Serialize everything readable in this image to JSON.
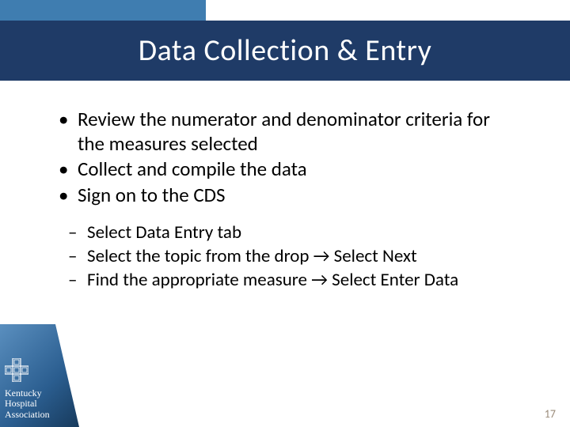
{
  "title": "Data Collection & Entry",
  "bullets": {
    "b1": "Review the numerator and denominator criteria for the measures selected",
    "b2": "Collect and compile the data",
    "b3": "Sign on to the CDS"
  },
  "sub": {
    "s1": "Select Data Entry tab",
    "s2": "Select the topic from the drop → Select Next",
    "s3": "Find the appropriate measure → Select Enter Data"
  },
  "footer": {
    "org_line1": "Kentucky",
    "org_line2": "Hospital",
    "org_line3": "Association"
  },
  "page_number": "17"
}
